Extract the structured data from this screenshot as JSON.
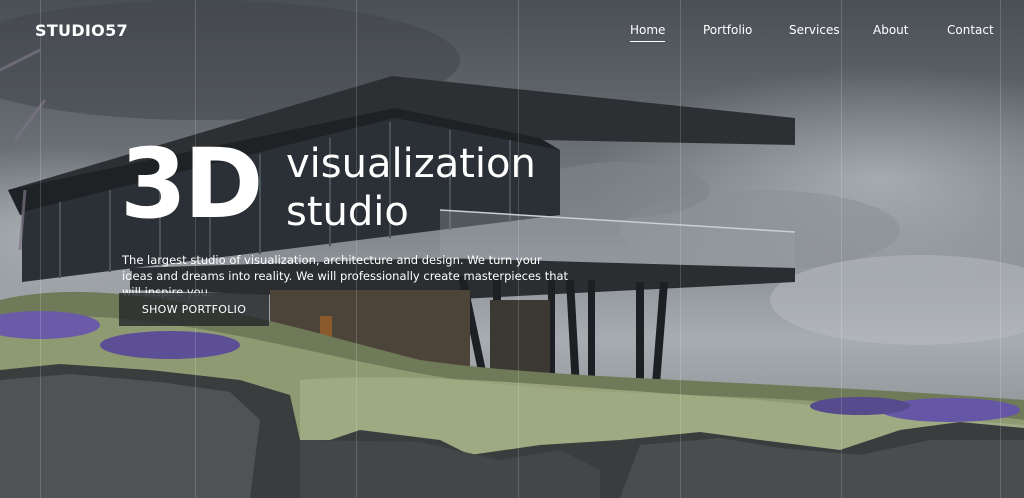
{
  "brand": {
    "logo": "STUDIO57"
  },
  "nav": {
    "items": [
      {
        "label": "Home",
        "active": true
      },
      {
        "label": "Portfolio",
        "active": false
      },
      {
        "label": "Services",
        "active": false
      },
      {
        "label": "About",
        "active": false
      },
      {
        "label": "Contact",
        "active": false
      }
    ]
  },
  "hero": {
    "title_big": "3D",
    "title_line1": "visualization",
    "title_line2": "studio",
    "description": "The largest studio of visualization, architecture and design. We turn your ideas and dreams into reality. We will professionally create masterpieces that will inspire you.",
    "cta_label": "SHOW PORTFOLIO",
    "background_image": "modern-cantilever-house-on-rocky-hill-photo"
  },
  "colors": {
    "text": "#ffffff",
    "button_bg": "#26282b",
    "sky": "#5b6269",
    "lavender": "#6b5aa8",
    "grass": "#8e9a72"
  }
}
